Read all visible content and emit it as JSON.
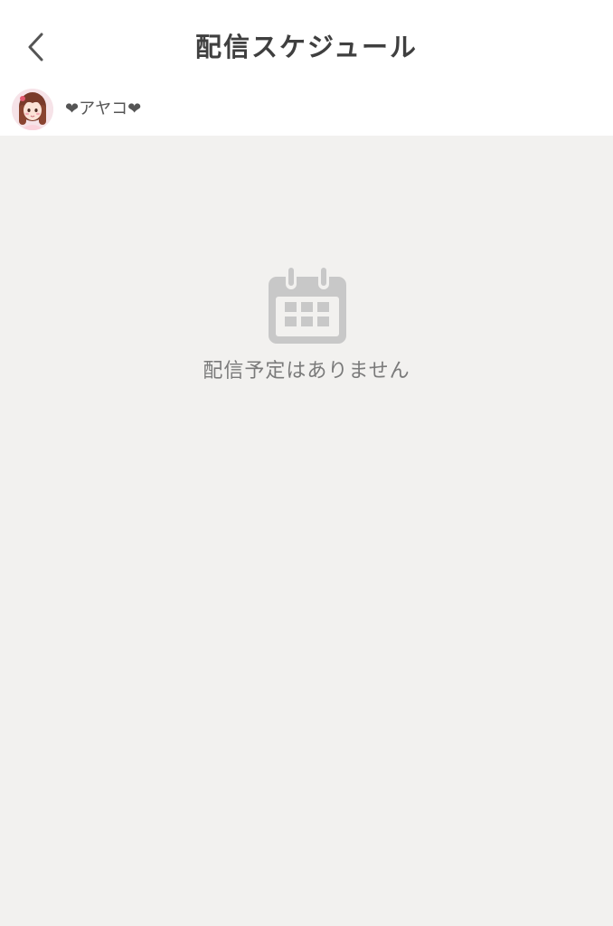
{
  "header": {
    "title": "配信スケジュール",
    "back_icon": "chevron-left-icon"
  },
  "user": {
    "name": "❤アヤコ❤",
    "avatar_icon": "user-avatar"
  },
  "empty_state": {
    "icon": "calendar-icon",
    "message": "配信予定はありません"
  },
  "colors": {
    "background": "#f2f1ef",
    "header_bg": "#ffffff",
    "title_text": "#3f3f3f",
    "icon_gray": "#c8c8c8",
    "muted_text": "#7a7a7a"
  }
}
